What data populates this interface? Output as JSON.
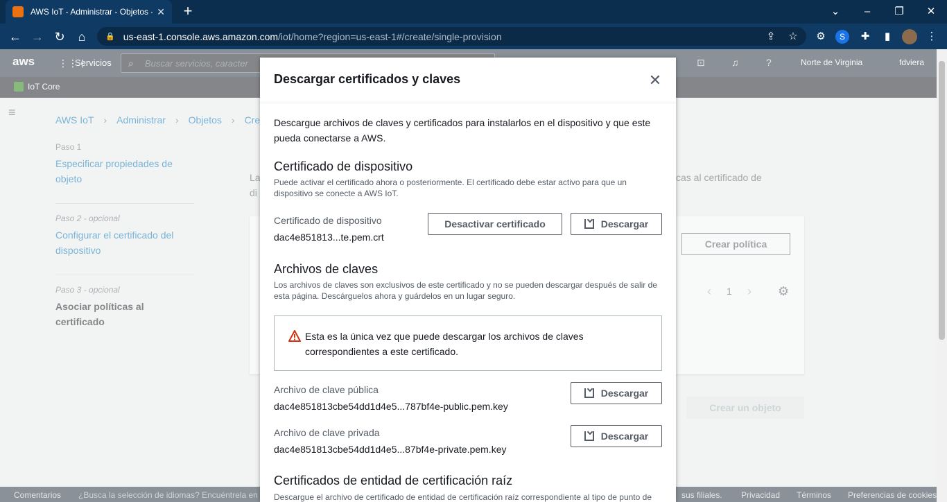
{
  "browser": {
    "tab_title": "AWS IoT - Administrar - Objetos - ",
    "url_host": "us-east-1.console.aws.amazon.com",
    "url_path": "/iot/home?region=us-east-1#/create/single-provision"
  },
  "console": {
    "logo": "aws",
    "services": "Servicios",
    "search_placeholder": "Buscar servicios, caracter",
    "region": "Norte de Virginia",
    "user": "fdviera",
    "service_name": "IoT Core",
    "breadcrumb": [
      "AWS IoT",
      "Administrar",
      "Objetos",
      "Crea"
    ],
    "steps": [
      {
        "label": "Paso 1",
        "title": "Especificar propiedades de objeto"
      },
      {
        "label": "Paso 2 - opcional",
        "title": "Configurar el certificado del dispositivo"
      },
      {
        "label": "Paso 3 - opcional",
        "title": "Asociar políticas al certificado"
      }
    ],
    "bg_text_a": "La",
    "bg_text_b": "di",
    "bg_right_text": "cas al certificado de",
    "crear_politica": "Crear política",
    "page_num": "1",
    "crear_objeto": "Crear un objeto",
    "footer": {
      "comentarios": "Comentarios",
      "idioma": "¿Busca la selección de idiomas? Encuéntrela en",
      "filiales": "sus filiales.",
      "privacidad": "Privacidad",
      "terminos": "Términos",
      "cookies": "Preferencias de cookies"
    }
  },
  "modal": {
    "title": "Descargar certificados y claves",
    "intro": "Descargue archivos de claves y certificados para instalarlos en el dispositivo y que este pueda conectarse a AWS.",
    "cert_heading": "Certificado de dispositivo",
    "cert_desc": "Puede activar el certificado ahora o posteriormente. El certificado debe estar activo para que un dispositivo se conecte a AWS IoT.",
    "cert_label": "Certificado de dispositivo",
    "cert_file": "dac4e851813...te.pem.crt",
    "deactivate_btn": "Desactivar certificado",
    "download_btn": "Descargar",
    "keys_heading": "Archivos de claves",
    "keys_desc": "Los archivos de claves son exclusivos de este certificado y no se pueden descargar después de salir de esta página. Descárguelos ahora y guárdelos en un lugar seguro.",
    "alert": "Esta es la única vez que puede descargar los archivos de claves correspondientes a este certificado.",
    "public_label": "Archivo de clave pública",
    "public_file": "dac4e851813cbe54dd1d4e5...787bf4e-public.pem.key",
    "private_label": "Archivo de clave privada",
    "private_file": "dac4e851813cbe54dd1d4e5...87bf4e-private.pem.key",
    "root_heading": "Certificados de entidad de certificación raíz",
    "root_desc": "Descargue el archivo de certificado de entidad de certificación raíz correspondiente al tipo de punto de"
  }
}
